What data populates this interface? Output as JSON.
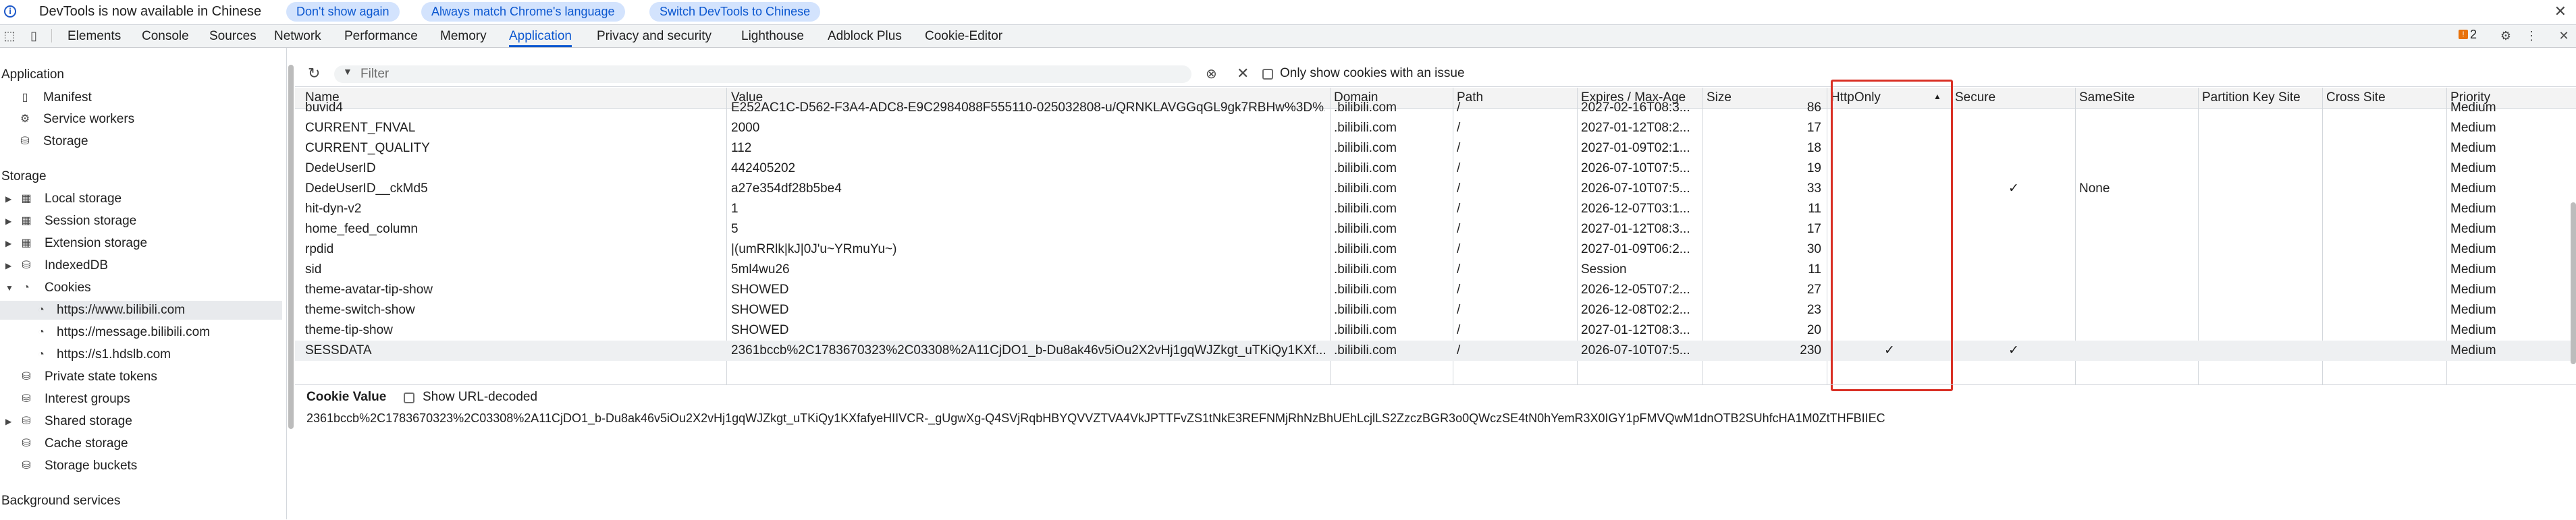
{
  "infobar": {
    "message": "DevTools is now available in Chinese",
    "buttons": [
      "Don't show again",
      "Always match Chrome's language",
      "Switch DevTools to Chinese"
    ]
  },
  "tabs": [
    "Elements",
    "Console",
    "Sources",
    "Network",
    "Performance",
    "Memory",
    "Application",
    "Privacy and security",
    "Lighthouse",
    "Adblock Plus",
    "Cookie-Editor"
  ],
  "active_tab": "Application",
  "issues_count": "2",
  "sidebar": {
    "application_header": "Application",
    "application_items": [
      "Manifest",
      "Service workers",
      "Storage"
    ],
    "storage_header": "Storage",
    "storage_items": [
      "Local storage",
      "Session storage",
      "Extension storage",
      "IndexedDB",
      "Cookies"
    ],
    "cookie_origins": [
      "https://www.bilibili.com",
      "https://message.bilibili.com",
      "https://s1.hdslb.com"
    ],
    "other_items": [
      "Private state tokens",
      "Interest groups",
      "Shared storage",
      "Cache storage",
      "Storage buckets"
    ],
    "background_header": "Background services"
  },
  "toolbar": {
    "filter_placeholder": "Filter",
    "only_issues_label": "Only show cookies with an issue"
  },
  "table": {
    "columns": [
      "Name",
      "Value",
      "Domain",
      "Path",
      "Expires / Max-Age",
      "Size",
      "HttpOnly",
      "Secure",
      "SameSite",
      "Partition Key Site",
      "Cross Site",
      "Priority"
    ],
    "sort_column": "HttpOnly",
    "rows": [
      {
        "name": "buvid4",
        "value": "E252AC1C-D562-F3A4-ADC8-E9C2984088F555110-025032808-u/QRNKLAVGGqGL9gk7RBHw%3D%...",
        "domain": ".bilibili.com",
        "path": "/",
        "expires": "2027-02-16T08:3...",
        "size": "86",
        "httponly": "",
        "secure": "",
        "samesite": "",
        "priority": "Medium"
      },
      {
        "name": "CURRENT_FNVAL",
        "value": "2000",
        "domain": ".bilibili.com",
        "path": "/",
        "expires": "2027-01-12T08:2...",
        "size": "17",
        "httponly": "",
        "secure": "",
        "samesite": "",
        "priority": "Medium"
      },
      {
        "name": "CURRENT_QUALITY",
        "value": "112",
        "domain": ".bilibili.com",
        "path": "/",
        "expires": "2027-01-09T02:1...",
        "size": "18",
        "httponly": "",
        "secure": "",
        "samesite": "",
        "priority": "Medium"
      },
      {
        "name": "DedeUserID",
        "value": "442405202",
        "domain": ".bilibili.com",
        "path": "/",
        "expires": "2026-07-10T07:5...",
        "size": "19",
        "httponly": "",
        "secure": "",
        "samesite": "",
        "priority": "Medium"
      },
      {
        "name": "DedeUserID__ckMd5",
        "value": "a27e354df28b5be4",
        "domain": ".bilibili.com",
        "path": "/",
        "expires": "2026-07-10T07:5...",
        "size": "33",
        "httponly": "",
        "secure": "✓",
        "samesite": "None",
        "priority": "Medium"
      },
      {
        "name": "hit-dyn-v2",
        "value": "1",
        "domain": ".bilibili.com",
        "path": "/",
        "expires": "2026-12-07T03:1...",
        "size": "11",
        "httponly": "",
        "secure": "",
        "samesite": "",
        "priority": "Medium"
      },
      {
        "name": "home_feed_column",
        "value": "5",
        "domain": ".bilibili.com",
        "path": "/",
        "expires": "2027-01-12T08:3...",
        "size": "17",
        "httponly": "",
        "secure": "",
        "samesite": "",
        "priority": "Medium"
      },
      {
        "name": "rpdid",
        "value": "|(umRRlk|kJ|0J'u~YRmuYu~)",
        "domain": ".bilibili.com",
        "path": "/",
        "expires": "2027-01-09T06:2...",
        "size": "30",
        "httponly": "",
        "secure": "",
        "samesite": "",
        "priority": "Medium"
      },
      {
        "name": "sid",
        "value": "5ml4wu26",
        "domain": ".bilibili.com",
        "path": "/",
        "expires": "Session",
        "size": "11",
        "httponly": "",
        "secure": "",
        "samesite": "",
        "priority": "Medium"
      },
      {
        "name": "theme-avatar-tip-show",
        "value": "SHOWED",
        "domain": ".bilibili.com",
        "path": "/",
        "expires": "2026-12-05T07:2...",
        "size": "27",
        "httponly": "",
        "secure": "",
        "samesite": "",
        "priority": "Medium"
      },
      {
        "name": "theme-switch-show",
        "value": "SHOWED",
        "domain": ".bilibili.com",
        "path": "/",
        "expires": "2026-12-08T02:2...",
        "size": "23",
        "httponly": "",
        "secure": "",
        "samesite": "",
        "priority": "Medium"
      },
      {
        "name": "theme-tip-show",
        "value": "SHOWED",
        "domain": ".bilibili.com",
        "path": "/",
        "expires": "2027-01-12T08:3...",
        "size": "20",
        "httponly": "",
        "secure": "",
        "samesite": "",
        "priority": "Medium"
      },
      {
        "name": "SESSDATA",
        "value": "2361bccb%2C1783670323%2C03308%2A11CjDO1_b-Du8ak46v5iOu2X2vHj1gqWJZkgt_uTKiQy1KXf...",
        "domain": ".bilibili.com",
        "path": "/",
        "expires": "2026-07-10T07:5...",
        "size": "230",
        "httponly": "✓",
        "secure": "✓",
        "samesite": "",
        "priority": "Medium"
      }
    ]
  },
  "cookie_value": {
    "label": "Cookie Value",
    "show_decoded_label": "Show URL-decoded",
    "value": "2361bccb%2C1783670323%2C03308%2A11CjDO1_b-Du8ak46v5iOu2X2vHj1gqWJZkgt_uTKiQy1KXfafyeHIIVCR-_gUgwXg-Q4SVjRqbHBYQVVZTVA4VkJPTTFvZS1tNkE3REFNMjRhNzBhUEhLcjlLS2ZzczBGR3o0QWczSE4tN0hYemR3X0IGY1pFMVQwM1dnOTB2SUhfcHA1M0ZtTHFBIIEC"
  },
  "colors": {
    "accent": "#0b57d0",
    "highlight_box": "#d93025",
    "selected_row": "#eef0f2"
  }
}
